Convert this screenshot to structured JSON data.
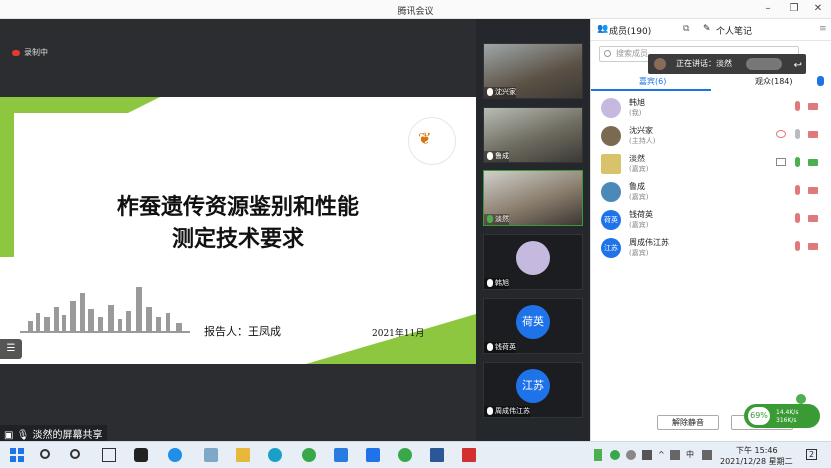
{
  "window": {
    "title": "腾讯会议",
    "min": "–",
    "restore": "❐",
    "close": "✕"
  },
  "stage": {
    "recording_label": "录制中",
    "slide": {
      "title_line1": "柞蚕遗传资源鉴别和性能",
      "title_line2": "测定技术要求",
      "reporter": "报告人：王凤成",
      "date": "2021年11月"
    },
    "share_label": "淡然的屏幕共享"
  },
  "tiles": [
    {
      "name": "沈兴家",
      "type": "video"
    },
    {
      "name": "鲁成",
      "type": "video"
    },
    {
      "name": "淡然",
      "type": "video"
    },
    {
      "name": "韩旭",
      "type": "image-avatar"
    },
    {
      "name": "钱荷英",
      "type": "text-avatar",
      "avatar_text": "荷英"
    },
    {
      "name": "周成伟江苏",
      "type": "text-avatar",
      "avatar_text": "江苏"
    }
  ],
  "panel": {
    "tab_members": "成员(190)",
    "tab_notes": "个人笔记",
    "search_placeholder": "搜索成员",
    "speaking": "正在讲话：淡然",
    "subtab_guests": "嘉宾(6)",
    "subtab_audience": "观众(184)",
    "members": [
      {
        "name": "韩旭",
        "role": "(我)",
        "avatar": "",
        "avatar_color": "#c6b9e0"
      },
      {
        "name": "沈兴家",
        "role": "(主持人)",
        "avatar": "",
        "avatar_color": "#7a6a52"
      },
      {
        "name": "淡然",
        "role": "(嘉宾)",
        "avatar": "",
        "avatar_color": "#d9c36a"
      },
      {
        "name": "鲁成",
        "role": "(嘉宾)",
        "avatar": "",
        "avatar_color": "#4a89b8"
      },
      {
        "name": "钱荷英",
        "role": "(嘉宾)",
        "avatar": "荷英",
        "avatar_color": "#1f73e8"
      },
      {
        "name": "周成伟江苏",
        "role": "(嘉宾)",
        "avatar": "江苏",
        "avatar_color": "#1f73e8"
      }
    ],
    "unmute_button": "解除静音"
  },
  "network": {
    "percent": "69%",
    "up": "14.4K/s",
    "down": "316K/s"
  },
  "taskbar": {
    "time": "下午 15:46",
    "date": "2021/12/28 星期二",
    "ime": "中",
    "notif_count": "2"
  },
  "colors": {
    "accent": "#1f73e8",
    "slide_green": "#8dc63f",
    "record_red": "#e53935"
  }
}
